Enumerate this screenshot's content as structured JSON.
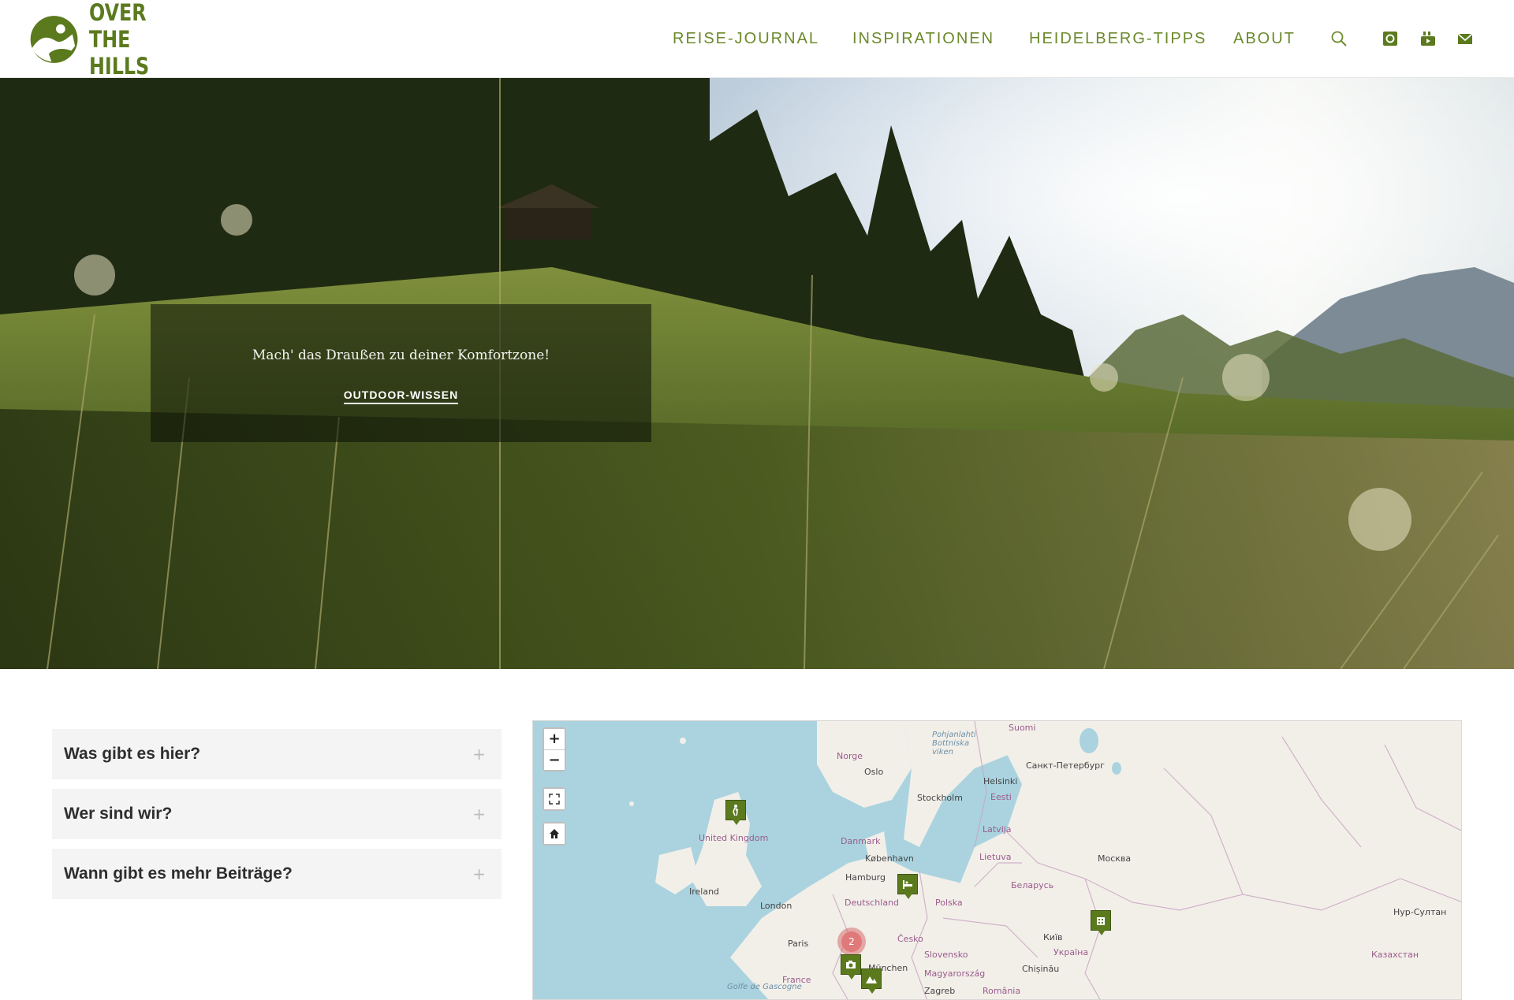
{
  "site": {
    "logo_line1": "OVER",
    "logo_line2": "THE HILLS"
  },
  "nav": {
    "items": [
      {
        "label": "REISE-JOURNAL"
      },
      {
        "label": "INSPIRATIONEN"
      },
      {
        "label": "HEIDELBERG-TIPPS"
      },
      {
        "label": "ABOUT"
      }
    ],
    "icons": [
      "search-icon",
      "instagram-icon",
      "youtube-icon",
      "mail-icon"
    ]
  },
  "hero": {
    "tagline": "Mach' das Draußen zu deiner Komfortzone!",
    "link_label": "OUTDOOR-WISSEN"
  },
  "accordion": {
    "items": [
      {
        "title": "Was gibt es hier?",
        "toggle": "+"
      },
      {
        "title": "Wer sind wir?",
        "toggle": "+"
      },
      {
        "title": "Wann gibt es mehr Beiträge?",
        "toggle": "+"
      }
    ]
  },
  "map": {
    "zoom_in": "+",
    "zoom_out": "−",
    "cluster_count": "2",
    "labels": {
      "suomi": "Suomi",
      "norge": "Norge",
      "oslo": "Oslo",
      "stockholm": "Stockholm",
      "helsinki": "Helsinki",
      "spb": "Санкт-Петербург",
      "eesti": "Eesti",
      "latvija": "Latvija",
      "lietuva": "Lietuva",
      "moskva": "Москва",
      "uk": "United Kingdom",
      "danmark": "Danmark",
      "kobenhavn": "København",
      "hamburg": "Hamburg",
      "ireland": "Ireland",
      "london": "London",
      "deutschland": "Deutschland",
      "polska": "Polska",
      "belarus": "Беларусь",
      "nursultan": "Нур-Султан",
      "paris": "Paris",
      "cesko": "Česko",
      "kyiv": "Київ",
      "ukraina": "Україна",
      "kazakhstan": "Казахстан",
      "slovensko": "Slovensko",
      "munchen": "München",
      "france": "France",
      "magyarorszag": "Magyarország",
      "chisinau": "Chișinău",
      "zagreb": "Zagreb",
      "romania": "România",
      "bothnia": "Pohjanlahti Bottniska viken",
      "biscay": "Golfe de Gascogne"
    }
  },
  "colors": {
    "brand_green": "#5b7a1e",
    "nav_text": "#6b8a2b",
    "accordion_bg": "#f4f4f4",
    "sea": "#aad3df",
    "land": "#f2efe9"
  }
}
